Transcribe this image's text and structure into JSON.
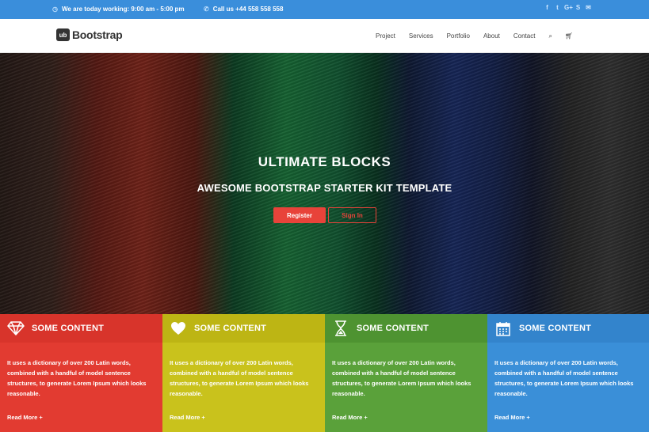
{
  "topbar": {
    "hours": "We are today working: 9:00 am - 5:00 pm",
    "phone": "Call us +44 558 558 558",
    "social_icons": [
      "facebook-icon",
      "twitter-icon",
      "google-plus-icon",
      "skype-icon",
      "mail-icon"
    ]
  },
  "brand": {
    "badge": "ub",
    "name": "Bootstrap"
  },
  "nav": {
    "items": [
      "Project",
      "Services",
      "Portfolio",
      "About",
      "Contact"
    ]
  },
  "hero": {
    "title": "ULTIMATE BLOCKS",
    "subtitle": "AWESOME BOOTSTRAP STARTER KIT TEMPLATE",
    "register": "Register",
    "signin": "Sign In"
  },
  "features": [
    {
      "icon": "diamond-icon",
      "title": "SOME CONTENT",
      "text": "It uses a dictionary of over 200 Latin words, combined with a handful of model sentence structures, to generate Lorem Ipsum which looks reasonable.",
      "more": "Read More +"
    },
    {
      "icon": "heart-icon",
      "title": "SOME CONTENT",
      "text": "It uses a dictionary of over 200 Latin words, combined with a handful of model sentence structures, to generate Lorem Ipsum which looks reasonable.",
      "more": "Read More +"
    },
    {
      "icon": "hourglass-icon",
      "title": "SOME CONTENT",
      "text": "It uses a dictionary of over 200 Latin words, combined with a handful of model sentence structures, to generate Lorem Ipsum which looks reasonable.",
      "more": "Read More +"
    },
    {
      "icon": "calendar-icon",
      "title": "SOME CONTENT",
      "text": "It uses a dictionary of over 200 Latin words, combined with a handful of model sentence structures, to generate Lorem Ipsum which looks reasonable.",
      "more": "Read More +"
    }
  ],
  "colors": {
    "topbar": "#3a8edb",
    "accent": "#e8433a",
    "red": "#e23b31",
    "yellow": "#c9c21c",
    "green": "#5aa13a",
    "blue": "#3a8fd8"
  }
}
